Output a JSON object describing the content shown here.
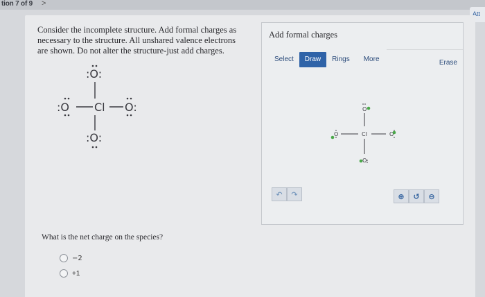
{
  "header": {
    "question_counter": "tion 7 of 9",
    "next_arrow": ">",
    "attempt_label": "Att"
  },
  "prompt": {
    "text": "Consider the incomplete structure. Add formal charges as necessary to the structure. All unshared valence electrons are shown. Do not alter the structure-just add charges."
  },
  "structure": {
    "top_atom": ":O:",
    "left_atom": ":O",
    "center_atom": "Cl",
    "right_atom": "O:",
    "bottom_atom": ":O:"
  },
  "editor": {
    "title": "Add formal charges",
    "tools": [
      {
        "label": "Select",
        "active": false
      },
      {
        "label": "Draw",
        "active": true
      },
      {
        "label": "Rings",
        "active": false
      },
      {
        "label": "More",
        "active": false
      }
    ],
    "erase_label": "Erase",
    "canvas": {
      "top": "O",
      "left": "O",
      "center": "Cl",
      "right": "O",
      "bottom": "O"
    },
    "undo_icon": "↶",
    "redo_icon": "↷",
    "zoom_in_icon": "⊕",
    "reset_icon": "↺",
    "zoom_out_icon": "⊖"
  },
  "question2": {
    "text": "What is the net charge on the species?",
    "options": [
      "−2",
      "+1"
    ]
  },
  "colors": {
    "accent": "#2f63a8",
    "highlight_green": "#4aa84a"
  }
}
